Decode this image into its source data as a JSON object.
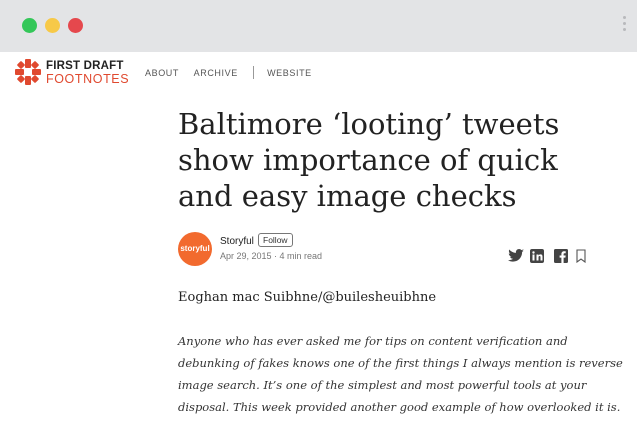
{
  "header": {
    "brand_line1": "FIRST DRAFT",
    "brand_line2": "FOOTNOTES",
    "nav": [
      {
        "label": "ABOUT"
      },
      {
        "label": "ARCHIVE"
      },
      {
        "label": "WEBSITE"
      }
    ]
  },
  "article": {
    "title": "Baltimore ‘looting’ tweets show importance of quick and easy image checks",
    "author": {
      "avatar_text": "storyful",
      "name": "Storyful",
      "follow_label": "Follow",
      "date_read": "Apr 29, 2015 · 4 min read"
    },
    "share_icons": [
      "twitter-icon",
      "linkedin-icon",
      "facebook-icon",
      "bookmark-icon"
    ],
    "byline": "Eoghan mac Suibhne/@builesheuibhne",
    "lede": "Anyone who has ever asked me for tips on content verification and debunking of fakes knows one of the first things I always mention is reverse image search. It’s one of the simplest and most powerful tools at your disposal. This week provided another good example of how overlooked it is."
  },
  "colors": {
    "brand_red": "#e0492f",
    "avatar_orange": "#f26a2e",
    "window_chrome": "#e3e4e6"
  }
}
